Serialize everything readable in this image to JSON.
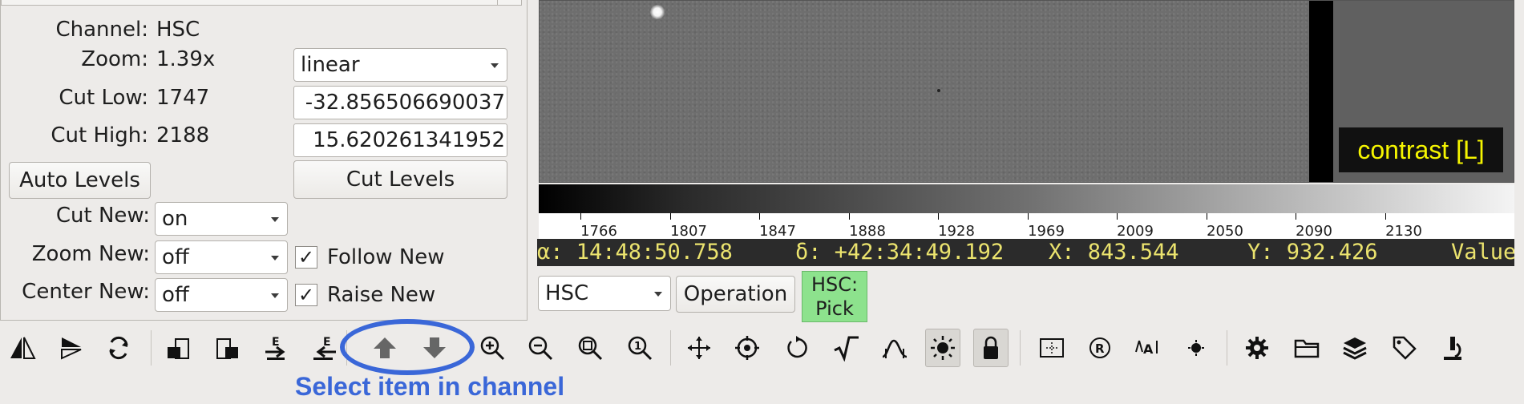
{
  "info_panel": {
    "channel_label": "Channel:",
    "channel_value": "HSC",
    "zoom_label": "Zoom:",
    "zoom_value": "1.39x",
    "cut_low_label": "Cut Low:",
    "cut_low_value": "1747",
    "cut_high_label": "Cut High:",
    "cut_high_value": "2188",
    "color_dist_select": "linear",
    "cut_low_entry": "-32.856506690037",
    "cut_high_entry": "15.620261341952",
    "auto_levels_label": "Auto Levels",
    "cut_levels_label": "Cut Levels",
    "cut_new_label": "Cut New:",
    "cut_new_value": "on",
    "zoom_new_label": "Zoom New:",
    "zoom_new_value": "off",
    "center_new_label": "Center New:",
    "center_new_value": "off",
    "follow_new_label": "Follow New",
    "follow_new_checked": true,
    "raise_new_label": "Raise New",
    "raise_new_checked": true
  },
  "viewer": {
    "mode_badge": "contrast [L]"
  },
  "colorbar": {
    "ticks": [
      "1766",
      "1807",
      "1847",
      "1888",
      "1928",
      "1969",
      "2009",
      "2050",
      "2090",
      "2130"
    ]
  },
  "readout": {
    "ra": "α: 14:48:50.758",
    "dec": "δ: +42:34:49.192",
    "x": "X: 843.544",
    "y": "Y: 932.426",
    "value": "Value"
  },
  "channel_bar": {
    "channel_select": "HSC",
    "operation_label": "Operation",
    "badge_line1": "HSC:",
    "badge_line2": "Pick"
  },
  "toolbar": {
    "icons": [
      "flip-x-icon",
      "flip-y-icon",
      "swap-xy-icon",
      "first-image-icon",
      "last-image-icon",
      "prev-image-icon",
      "next-image-icon",
      "up-arrow-icon",
      "down-arrow-icon",
      "zoom-in-icon",
      "zoom-out-icon",
      "zoom-fit-icon",
      "zoom-100-icon",
      "pan-icon",
      "center-icon",
      "rotate-icon",
      "sqrt-dist-icon",
      "cmap-icon",
      "contrast-icon",
      "lock-icon",
      "crosshair-icon",
      "rotate-reset-icon",
      "auto-cut-icon",
      "star-icon",
      "settings-icon",
      "folder-icon",
      "layers-icon",
      "tag-icon",
      "microscope-icon"
    ]
  },
  "annotation": {
    "text": "Select item in channel"
  },
  "colors": {
    "accent": "#3a67d8",
    "badge_bg": "#8de28d",
    "readout_bg": "#2b2b2b",
    "readout_fg": "#ebe36e",
    "contrast_fg": "#f5f500"
  }
}
